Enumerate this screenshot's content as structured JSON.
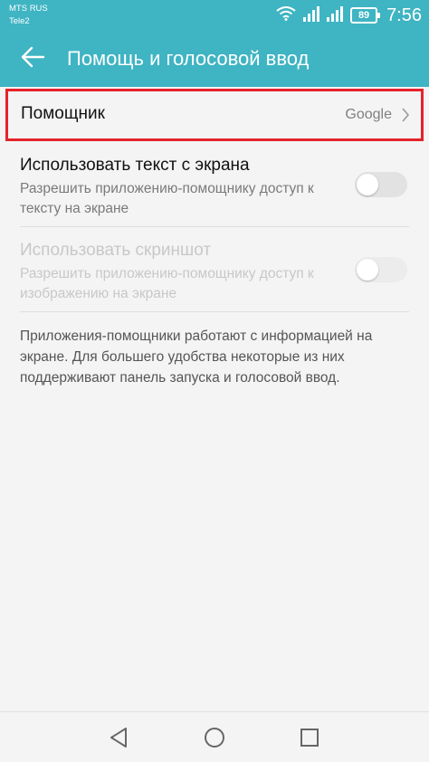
{
  "status_bar": {
    "carrier_1": "MTS RUS",
    "carrier_2": "Tele2",
    "battery": "89",
    "time": "7:56",
    "icons": [
      "wifi-icon",
      "signal-icon",
      "signal-icon",
      "battery-icon"
    ]
  },
  "app_bar": {
    "title": "Помощь и голосовой ввод",
    "back_icon": "arrow-left-icon"
  },
  "assistant": {
    "label": "Помощник",
    "value": "Google",
    "icon": "chevron-right-icon"
  },
  "settings": [
    {
      "title": "Использовать текст с экрана",
      "subtitle": "Разрешить приложению-помощнику доступ к тексту на экране",
      "enabled": true,
      "toggle_on": false
    },
    {
      "title": "Использовать скриншот",
      "subtitle": "Разрешить приложению-помощнику доступ к изображению на экране",
      "enabled": false,
      "toggle_on": false
    }
  ],
  "info_text": "Приложения-помощники работают с информацией на экране. Для большего удобства некоторые из них поддерживают панель запуска и голосовой ввод.",
  "nav_bar": {
    "icons": [
      "back-triangle-icon",
      "home-circle-icon",
      "recents-square-icon"
    ]
  },
  "colors": {
    "accent": "#3fb4c3",
    "highlight_border": "#e5232b",
    "background": "#f4f4f4"
  }
}
